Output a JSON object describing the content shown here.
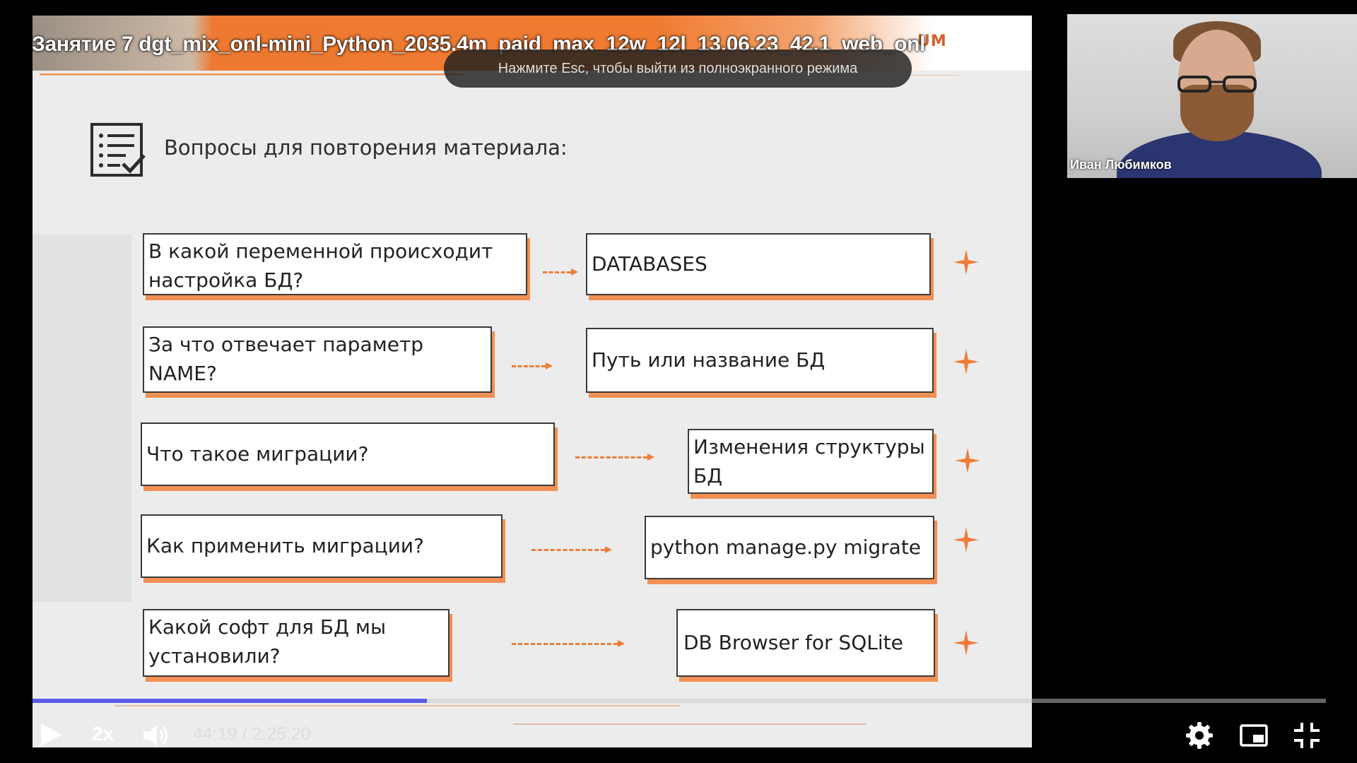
{
  "video": {
    "title": "Занятие 7 dgt_mix_onl-mini_Python_2035.4m_paid_max_12w_12l_13.06.23_42.1_web_onl",
    "esc_hint": "Нажмите Esc, чтобы выйти из полноэкранного режима"
  },
  "slide": {
    "logo": "UM",
    "title": "Вопросы для повторения материала:",
    "rows": [
      {
        "question": "В какой переменной происходит настройка БД?",
        "answer": "DATABASES"
      },
      {
        "question": "За что отвечает параметр NAME?",
        "answer": "Путь или название БД"
      },
      {
        "question": "Что такое миграции?",
        "answer": "Изменения структуры БД"
      },
      {
        "question": "Как применить миграции?",
        "answer": "python manage.py migrate"
      },
      {
        "question": "Какой софт для БД мы установили?",
        "answer": "DB Browser for SQLite"
      }
    ],
    "accent_color": "#ef7d3a"
  },
  "webcam": {
    "speaker_name": "Иван Любимков"
  },
  "player": {
    "speed": "2x",
    "current_time": "44:19",
    "separator": " / ",
    "duration": "2:25:20",
    "progress": 0.305,
    "progress_color": "#5b5be8",
    "icons": [
      "play-icon",
      "volume-icon",
      "settings-gear-icon",
      "miniplayer-icon",
      "exit-fullscreen-icon"
    ]
  }
}
